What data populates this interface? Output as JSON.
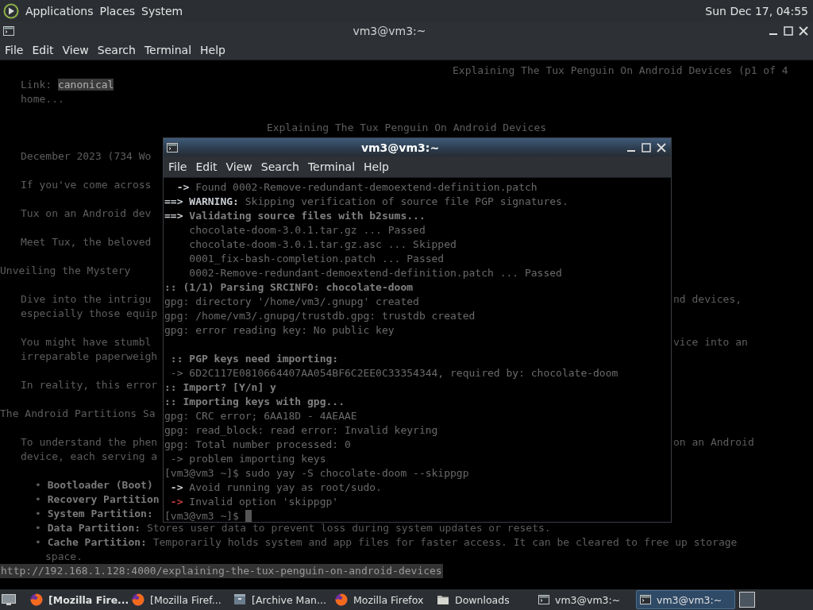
{
  "top_panel": {
    "menus": [
      "Applications",
      "Places",
      "System"
    ],
    "clock": "Sun Dec 17, 04:55"
  },
  "background_window": {
    "title": "vm3@vm3:~",
    "menu": [
      "File",
      "Edit",
      "View",
      "Search",
      "Terminal",
      "Help"
    ],
    "lines": [
      {
        "kind": "right",
        "segments": [
          {
            "text": "Explaining The Tux Penguin On Android Devices (p1 of 4",
            "kind": "dim"
          }
        ]
      },
      {
        "kind": "body",
        "segments": [
          {
            "text": "Link: ",
            "kind": "dim"
          },
          {
            "text": "canonical",
            "kind": "highlight"
          }
        ]
      },
      {
        "kind": "body",
        "segments": [
          {
            "text": "home...",
            "kind": "dim"
          }
        ]
      },
      {
        "kind": "blank"
      },
      {
        "kind": "center",
        "segments": [
          {
            "text": "Explaining The Tux Penguin On Android Devices",
            "kind": "dim"
          }
        ]
      },
      {
        "kind": "blank"
      },
      {
        "kind": "body",
        "segments": [
          {
            "text": "December 2023 (734 Wo",
            "kind": "dim"
          }
        ]
      },
      {
        "kind": "blank"
      },
      {
        "kind": "body",
        "segments": [
          {
            "text": "If you've come across",
            "kind": "dim"
          }
        ]
      },
      {
        "kind": "blank"
      },
      {
        "kind": "body",
        "segments": [
          {
            "text": "Tux on an Android dev",
            "kind": "dim"
          }
        ]
      },
      {
        "kind": "blank"
      },
      {
        "kind": "body",
        "segments": [
          {
            "text": "Meet Tux, the beloved",
            "kind": "dim"
          }
        ]
      },
      {
        "kind": "blank"
      },
      {
        "kind": "heading",
        "segments": [
          {
            "text": "Unveiling the Mystery",
            "kind": "dim"
          }
        ]
      },
      {
        "kind": "blank"
      },
      {
        "kind": "body",
        "segments": [
          {
            "text": "Dive into the intrigu",
            "kind": "dim"
          }
        ],
        "tail": "nd devices,"
      },
      {
        "kind": "body",
        "segments": [
          {
            "text": "especially those equip",
            "kind": "dim"
          }
        ]
      },
      {
        "kind": "blank"
      },
      {
        "kind": "body",
        "segments": [
          {
            "text": "You might have stumbl",
            "kind": "dim"
          }
        ],
        "tail": "vice into an"
      },
      {
        "kind": "body",
        "segments": [
          {
            "text": "irreparable paperweigh",
            "kind": "dim"
          }
        ]
      },
      {
        "kind": "blank"
      },
      {
        "kind": "body",
        "segments": [
          {
            "text": "In reality, this error",
            "kind": "dim"
          }
        ]
      },
      {
        "kind": "blank"
      },
      {
        "kind": "heading",
        "segments": [
          {
            "text": "The Android Partitions Sa",
            "kind": "dim"
          }
        ]
      },
      {
        "kind": "blank"
      },
      {
        "kind": "body",
        "segments": [
          {
            "text": "To understand the phen",
            "kind": "dim"
          }
        ],
        "tail": "on an Android"
      },
      {
        "kind": "body",
        "segments": [
          {
            "text": "device, each serving a",
            "kind": "dim"
          }
        ]
      },
      {
        "kind": "blank"
      },
      {
        "kind": "bullet",
        "segments": [
          {
            "text": "• ",
            "kind": "dim"
          },
          {
            "text": "Bootloader (Boot)",
            "kind": "bold"
          }
        ]
      },
      {
        "kind": "bullet",
        "segments": [
          {
            "text": "• ",
            "kind": "dim"
          },
          {
            "text": "Recovery Partition",
            "kind": "bold"
          }
        ]
      },
      {
        "kind": "bullet",
        "segments": [
          {
            "text": "• ",
            "kind": "dim"
          },
          {
            "text": "System Partition:",
            "kind": "bold"
          }
        ]
      },
      {
        "kind": "bullet",
        "segments": [
          {
            "text": "• ",
            "kind": "dim"
          },
          {
            "text": "Data Partition:",
            "kind": "bold"
          },
          {
            "text": " Stores user data to prevent loss during system updates or resets.",
            "kind": "dim"
          }
        ]
      },
      {
        "kind": "bullet",
        "segments": [
          {
            "text": "• ",
            "kind": "dim"
          },
          {
            "text": "Cache Partition:",
            "kind": "bold"
          },
          {
            "text": " Temporarily holds system and app files for faster access. It can be cleared to free up storage",
            "kind": "dim"
          }
        ]
      },
      {
        "kind": "wrap",
        "segments": [
          {
            "text": "space.",
            "kind": "dim"
          }
        ]
      }
    ],
    "status_url": "http://192.168.1.128:4000/explaining-the-tux-penguin-on-android-devices"
  },
  "front_window": {
    "title": "vm3@vm3:~",
    "menu": [
      "File",
      "Edit",
      "View",
      "Search",
      "Terminal",
      "Help"
    ],
    "lines": [
      {
        "segments": [
          {
            "text": "  ->",
            "kind": "bright"
          },
          {
            "text": " Found 0002-Remove-redundant-demoextend-definition.patch",
            "kind": "dim"
          }
        ]
      },
      {
        "segments": [
          {
            "text": "==> WARNING:",
            "kind": "bright"
          },
          {
            "text": " Skipping verification of source file PGP signatures.",
            "kind": "dim"
          }
        ]
      },
      {
        "segments": [
          {
            "text": "==>",
            "kind": "bright"
          },
          {
            "text": " Validating source files with b2sums...",
            "kind": "bold"
          }
        ]
      },
      {
        "segments": [
          {
            "text": "    chocolate-doom-3.0.1.tar.gz ... Passed",
            "kind": "dim"
          }
        ]
      },
      {
        "segments": [
          {
            "text": "    chocolate-doom-3.0.1.tar.gz.asc ... Skipped",
            "kind": "dim"
          }
        ]
      },
      {
        "segments": [
          {
            "text": "    0001_fix-bash-completion.patch ... Passed",
            "kind": "dim"
          }
        ]
      },
      {
        "segments": [
          {
            "text": "    0002-Remove-redundant-demoextend-definition.patch ... Passed",
            "kind": "dim"
          }
        ]
      },
      {
        "segments": [
          {
            "text": ":: (1/1) Parsing SRCINFO: chocolate-doom",
            "kind": "bold"
          }
        ]
      },
      {
        "segments": [
          {
            "text": "gpg: directory '/home/vm3/.gnupg' created",
            "kind": "dim"
          }
        ]
      },
      {
        "segments": [
          {
            "text": "gpg: /home/vm3/.gnupg/trustdb.gpg: trustdb created",
            "kind": "dim"
          }
        ]
      },
      {
        "segments": [
          {
            "text": "gpg: error reading key: No public key",
            "kind": "dim"
          }
        ]
      },
      {
        "kind": "blank"
      },
      {
        "segments": [
          {
            "text": " :: PGP keys need importing:",
            "kind": "bold"
          }
        ]
      },
      {
        "segments": [
          {
            "text": " -> 6D2C117E0810664407AA054BF6C2EE0C33354344, required by: chocolate-doom",
            "kind": "dim"
          }
        ]
      },
      {
        "segments": [
          {
            "text": ":: Import? [Y/n] y",
            "kind": "bold"
          }
        ]
      },
      {
        "segments": [
          {
            "text": ":: Importing keys with gpg...",
            "kind": "bold"
          }
        ]
      },
      {
        "segments": [
          {
            "text": "gpg: CRC error; 6AA18D - 4AEAAE",
            "kind": "dim"
          }
        ]
      },
      {
        "segments": [
          {
            "text": "gpg: read_block: read error: Invalid keyring",
            "kind": "dim"
          }
        ]
      },
      {
        "segments": [
          {
            "text": "gpg: Total number processed: 0",
            "kind": "dim"
          }
        ]
      },
      {
        "segments": [
          {
            "text": " -> problem importing keys",
            "kind": "dim"
          }
        ]
      },
      {
        "segments": [
          {
            "text": "[vm3@vm3 ~]$ sudo yay -S chocolate-doom --skippgp",
            "kind": "dim"
          }
        ]
      },
      {
        "segments": [
          {
            "text": " ->",
            "kind": "bright"
          },
          {
            "text": " Avoid running yay as root/sudo.",
            "kind": "dim"
          }
        ]
      },
      {
        "segments": [
          {
            "text": " ->",
            "kind": "red"
          },
          {
            "text": " Invalid option 'skippgp'",
            "kind": "dim"
          }
        ]
      },
      {
        "segments": [
          {
            "text": "[vm3@vm3 ~]$ ",
            "kind": "dim"
          }
        ],
        "cursor": true
      }
    ]
  },
  "taskbar": {
    "tasks": [
      {
        "label": "[Mozilla Fire...",
        "kind": "browser",
        "urgent": true,
        "selected": false
      },
      {
        "label": "[Mozilla Firef...",
        "kind": "browser",
        "urgent": false,
        "selected": false
      },
      {
        "label": "[Archive Man...",
        "kind": "archive",
        "urgent": false,
        "selected": false
      },
      {
        "label": "Mozilla Firefox",
        "kind": "browser",
        "urgent": false,
        "selected": false
      },
      {
        "label": "Downloads",
        "kind": "folder",
        "urgent": false,
        "selected": false
      },
      {
        "label": "vm3@vm3:~",
        "kind": "terminal",
        "urgent": false,
        "selected": false
      },
      {
        "label": "vm3@vm3:~",
        "kind": "terminal",
        "urgent": false,
        "selected": true
      }
    ]
  }
}
